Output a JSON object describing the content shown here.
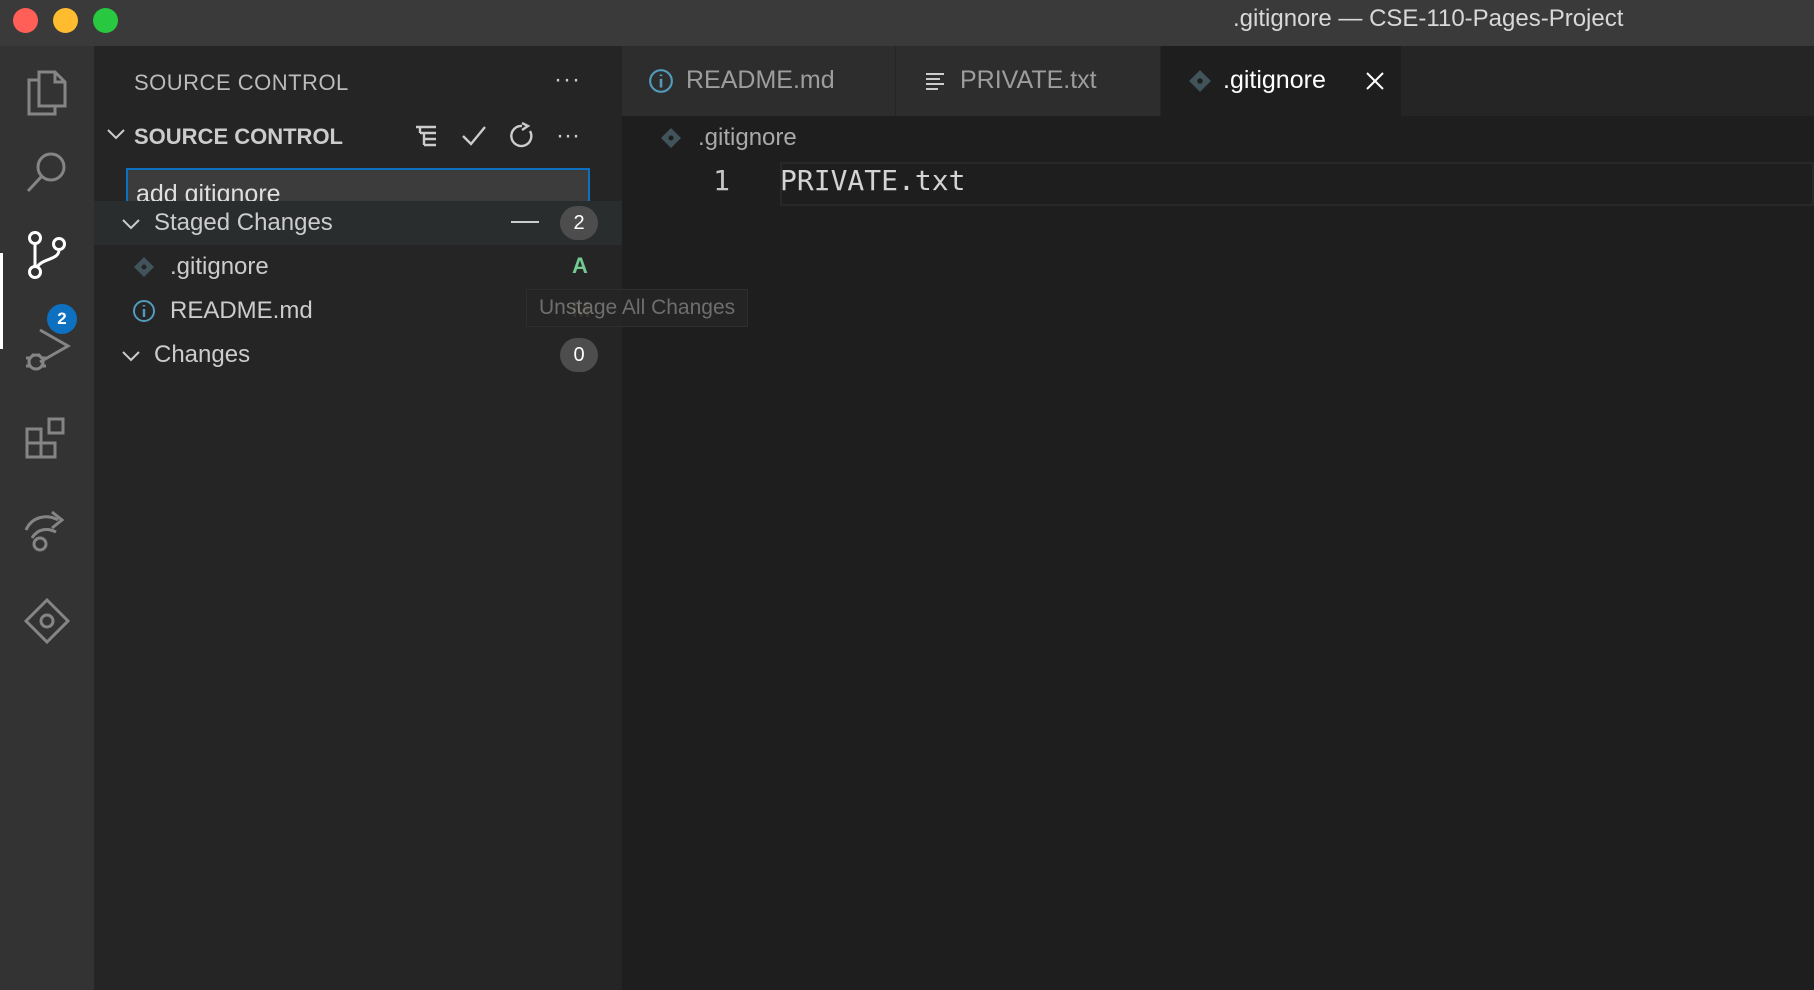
{
  "window": {
    "title": ".gitignore — CSE-110-Pages-Project"
  },
  "activity_bar": {
    "items": [
      "explorer-icon",
      "search-icon",
      "source-control-icon",
      "run-debug-icon",
      "extensions-icon",
      "remote-explorer-icon",
      "gitlens-icon"
    ],
    "active": "source-control-icon",
    "scm_badge": "2"
  },
  "sidebar": {
    "header": "SOURCE CONTROL",
    "section_title": "SOURCE CONTROL",
    "commit_message": "add gitignore",
    "staged": {
      "title": "Staged Changes",
      "count": "2",
      "files": [
        {
          "name": ".gitignore",
          "status": "A",
          "status_color": "#73c991",
          "icon": "git-file-icon"
        },
        {
          "name": "README.md",
          "status": "M",
          "status_color": "#e2c08d",
          "icon": "info-file-icon"
        }
      ]
    },
    "changes": {
      "title": "Changes",
      "count": "0"
    },
    "tooltip": "Unstage All Changes"
  },
  "tabs": [
    {
      "label": "README.md",
      "icon": "info-file-icon",
      "active": false
    },
    {
      "label": "PRIVATE.txt",
      "icon": "text-file-icon",
      "active": false
    },
    {
      "label": ".gitignore",
      "icon": "git-file-icon",
      "active": true
    }
  ],
  "editor": {
    "breadcrumb": ".gitignore",
    "lines": [
      {
        "number": "1",
        "text": "PRIVATE.txt"
      }
    ]
  },
  "colors": {
    "accent": "#0e70c0",
    "added": "#73c991",
    "modified": "#e2c08d"
  }
}
